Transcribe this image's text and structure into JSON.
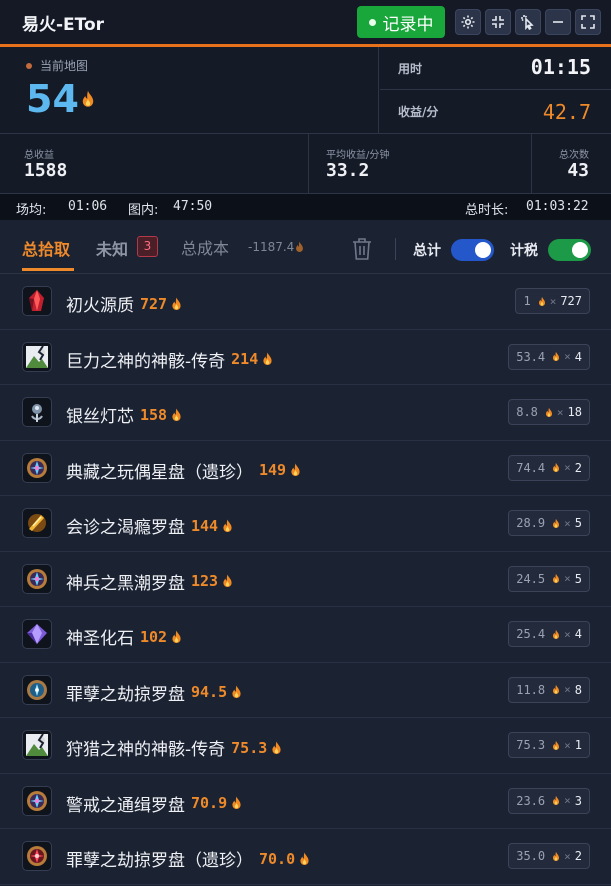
{
  "app": {
    "title": "易火-ETor",
    "record_label": "记录中"
  },
  "stats": {
    "map_label": "当前地图",
    "map_value": "54",
    "time_label": "用时",
    "time_value": "01:15",
    "rate_label": "收益/分",
    "rate_value": "42.7",
    "total_income_label": "总收益",
    "total_income_value": "1588",
    "avg_label": "平均收益/分钟",
    "avg_value": "33.2",
    "count_label": "总次数",
    "count_value": "43"
  },
  "info": {
    "field_avg_label": "场均:",
    "field_avg_value": "01:06",
    "in_map_label": "图内:",
    "in_map_value": "47:50",
    "total_duration_label": "总时长:",
    "total_duration_value": "01:03:22"
  },
  "tabs": {
    "total": "总拾取",
    "unknown": "未知",
    "unknown_count": "3",
    "cost": "总成本",
    "cost_value": "-1187.4",
    "sum_label": "总计",
    "sum_on": true,
    "tax_label": "计税",
    "tax_on": true
  },
  "items": [
    {
      "name": "初火源质",
      "price": "727",
      "unit": "1",
      "qty": "727",
      "icon": "red-crystal-icon"
    },
    {
      "name": "巨力之神的神骸-传奇",
      "price": "214",
      "unit": "53.4",
      "qty": "4",
      "icon": "broken-image-icon"
    },
    {
      "name": "银丝灯芯",
      "price": "158",
      "unit": "8.8",
      "qty": "18",
      "icon": "silver-wick-icon"
    },
    {
      "name": "典藏之玩偶星盘（遗珍）",
      "price": "149",
      "unit": "74.4",
      "qty": "2",
      "icon": "star-compass-icon"
    },
    {
      "name": "会诊之渴瘾罗盘",
      "price": "144",
      "unit": "28.9",
      "qty": "5",
      "icon": "gold-compass-icon"
    },
    {
      "name": "神兵之黑潮罗盘",
      "price": "123",
      "unit": "24.5",
      "qty": "5",
      "icon": "star-compass-icon"
    },
    {
      "name": "神圣化石",
      "price": "102",
      "unit": "25.4",
      "qty": "4",
      "icon": "purple-fossil-icon"
    },
    {
      "name": "罪孽之劫掠罗盘",
      "price": "94.5",
      "unit": "11.8",
      "qty": "8",
      "icon": "blue-compass-icon"
    },
    {
      "name": "狩猎之神的神骸-传奇",
      "price": "75.3",
      "unit": "75.3",
      "qty": "1",
      "icon": "broken-image-icon"
    },
    {
      "name": "警戒之通缉罗盘",
      "price": "70.9",
      "unit": "23.6",
      "qty": "3",
      "icon": "star-compass-icon"
    },
    {
      "name": "罪孽之劫掠罗盘（遗珍）",
      "price": "70.0",
      "unit": "35.0",
      "qty": "2",
      "icon": "red-compass-icon"
    }
  ],
  "colors": {
    "accent": "#e8711b",
    "price_orange": "#ef8a2b",
    "record_green": "#19a63a",
    "map_blue": "#5db8ef",
    "background": "#1b2232"
  }
}
